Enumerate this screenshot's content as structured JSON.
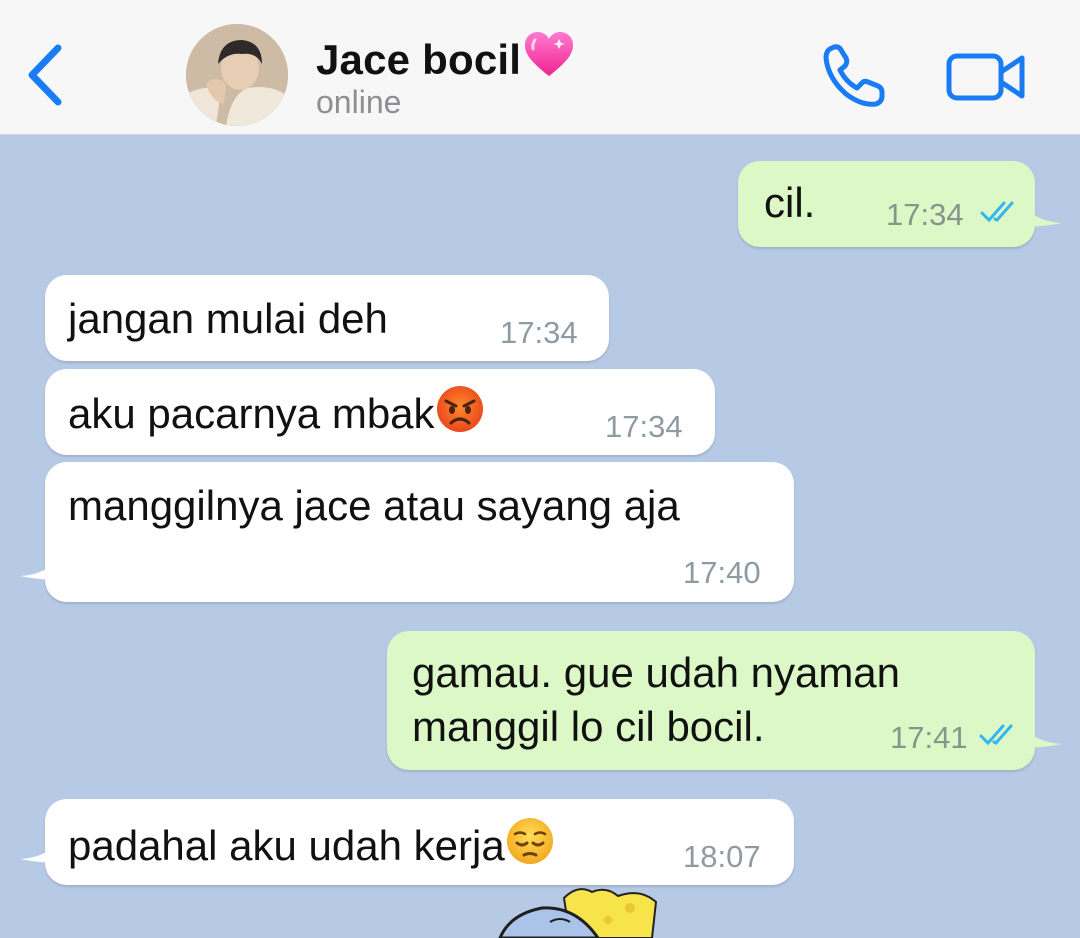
{
  "header": {
    "contact_name": "Jace bocil",
    "name_emoji": "pink-heart-icon",
    "status": "online",
    "back_icon": "chevron-left-icon",
    "call_icon": "phone-icon",
    "video_icon": "video-camera-icon",
    "accent_color": "#1a7cf5"
  },
  "messages": [
    {
      "direction": "out",
      "text": "cil.",
      "time": "17:34",
      "read": true
    },
    {
      "direction": "in",
      "text": "jangan mulai deh",
      "time": "17:34"
    },
    {
      "direction": "in",
      "text": "aku pacarnya mbak",
      "emoji": "angry-face-icon",
      "time": "17:34"
    },
    {
      "direction": "in",
      "text": "manggilnya jace atau sayang aja",
      "time": "17:40"
    },
    {
      "direction": "out",
      "lines": [
        "gamau. gue udah nyaman",
        "manggil lo cil bocil."
      ],
      "time": "17:41",
      "read": true
    },
    {
      "direction": "in",
      "text": "padahal aku udah kerja",
      "emoji": "pensive-face-icon",
      "time": "18:07"
    }
  ],
  "colors": {
    "chat_background": "#b6c9e5",
    "incoming_bubble": "#ffffff",
    "outgoing_bubble": "#dcf8c6",
    "read_ticks": "#34b7f1"
  }
}
